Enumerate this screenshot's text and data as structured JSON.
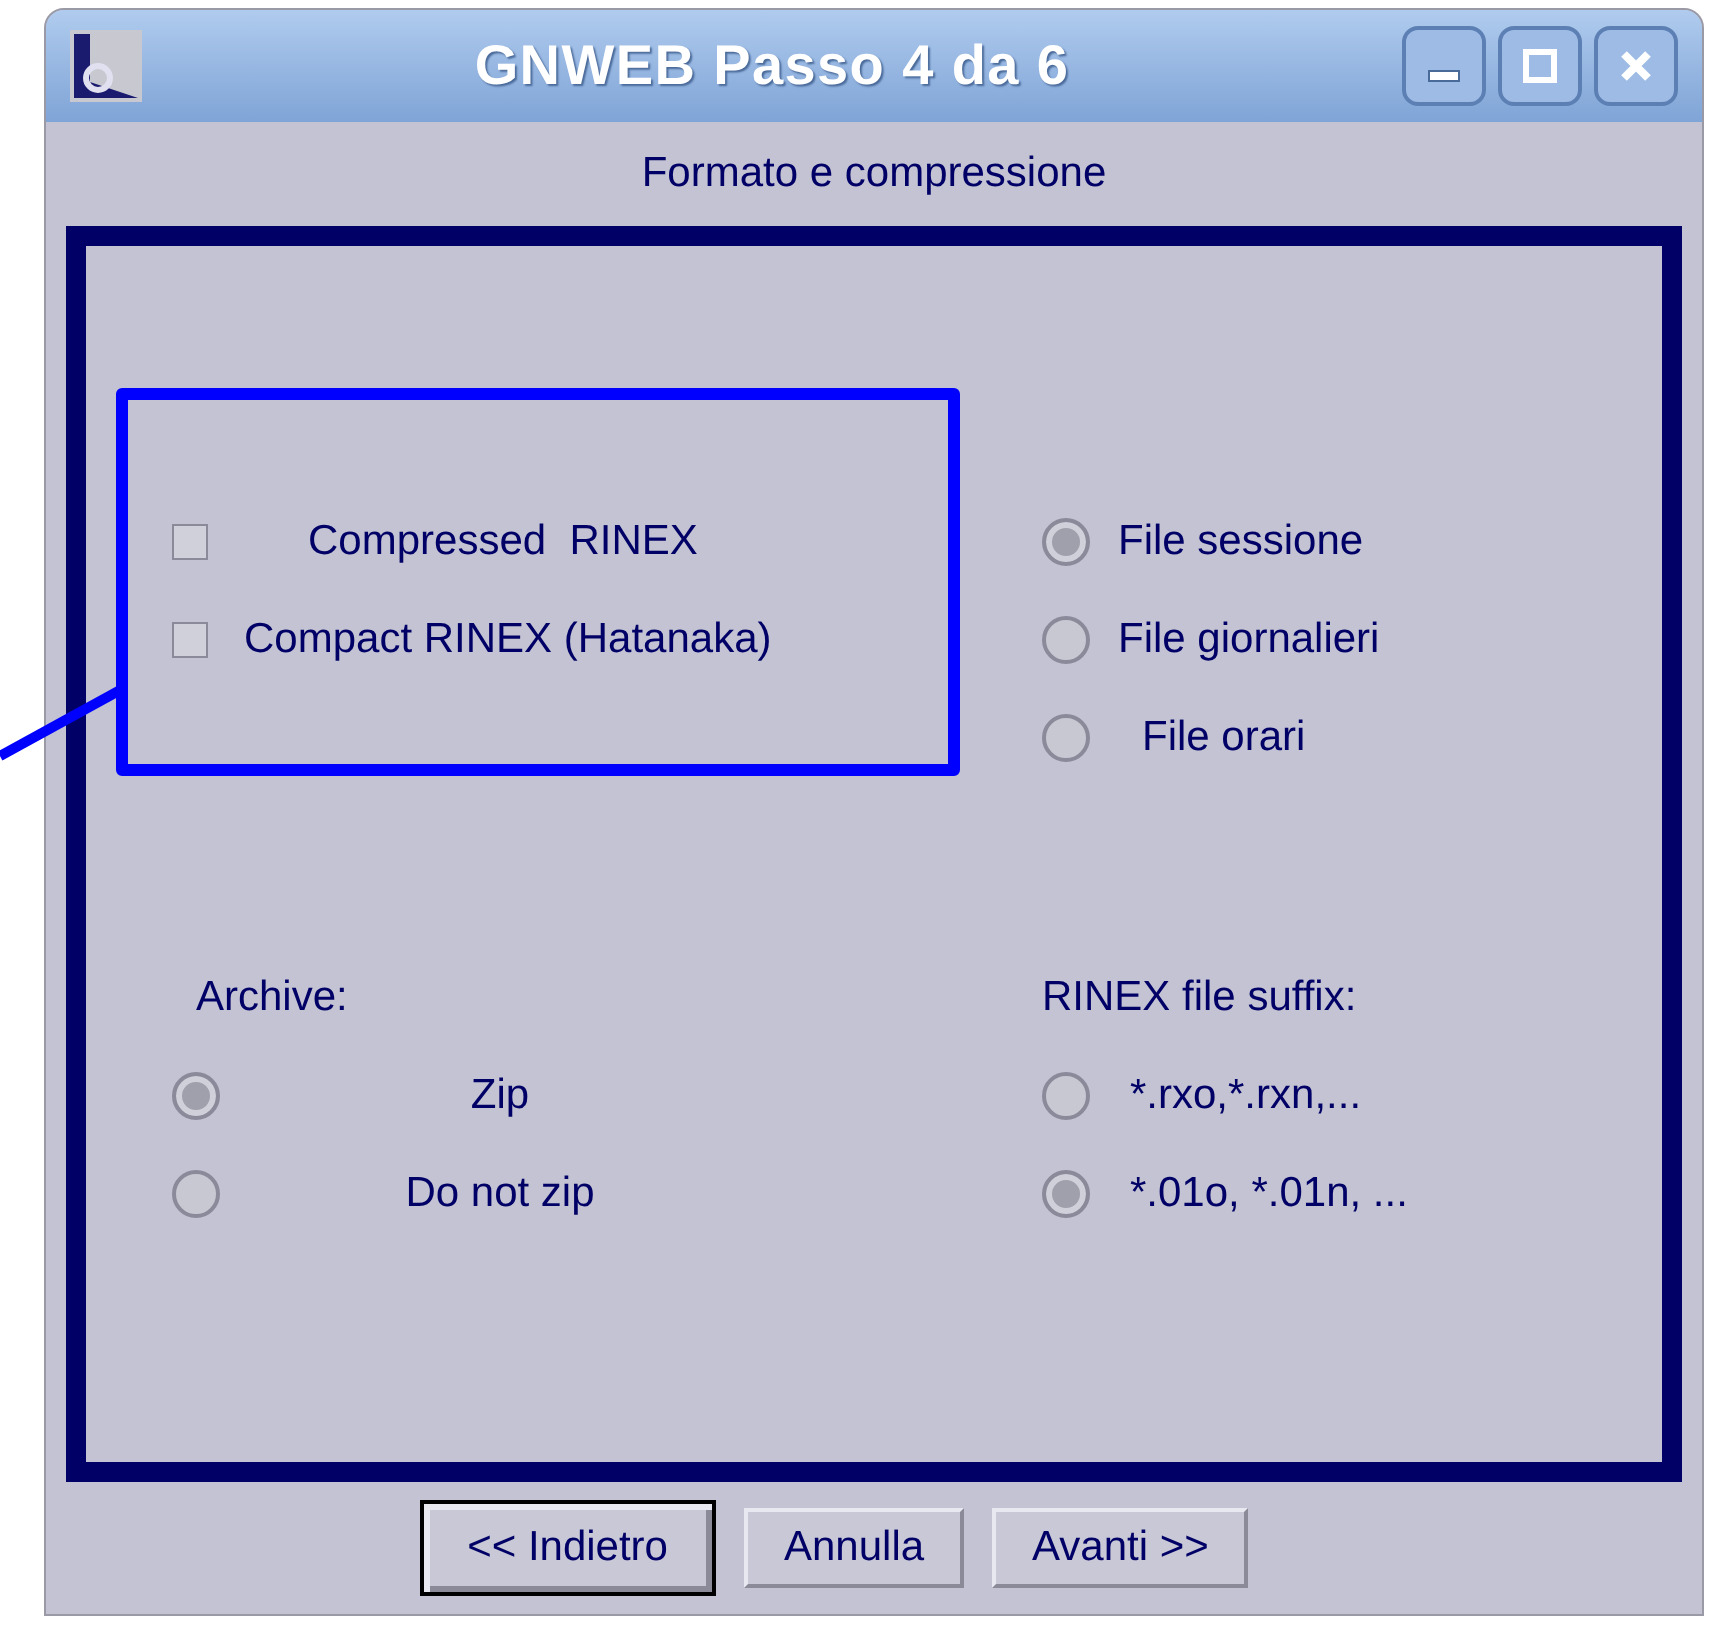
{
  "window": {
    "title": "GNWEB Passo 4 da 6",
    "subtitle": "Formato e compressione"
  },
  "compression": [
    {
      "label": "Compressed  RINEX",
      "checked": false
    },
    {
      "label": "Compact RINEX (Hatanaka)",
      "checked": false
    }
  ],
  "file_type": [
    {
      "label": "File sessione",
      "selected": true
    },
    {
      "label": "File giornalieri",
      "selected": false
    },
    {
      "label": "File orari",
      "selected": false
    }
  ],
  "archive": {
    "label": "Archive:",
    "options": [
      {
        "label": "Zip",
        "selected": true
      },
      {
        "label": "Do not zip",
        "selected": false
      }
    ]
  },
  "suffix": {
    "label": "RINEX file suffix:",
    "options": [
      {
        "label": "*.rxo,*.rxn,...",
        "selected": false
      },
      {
        "label": "*.01o, *.01n, ...",
        "selected": true
      }
    ]
  },
  "buttons": [
    {
      "label": "<< Indietro",
      "focused": true
    },
    {
      "label": "Annulla",
      "focused": false
    },
    {
      "label": "Avanti >>",
      "focused": false
    }
  ]
}
